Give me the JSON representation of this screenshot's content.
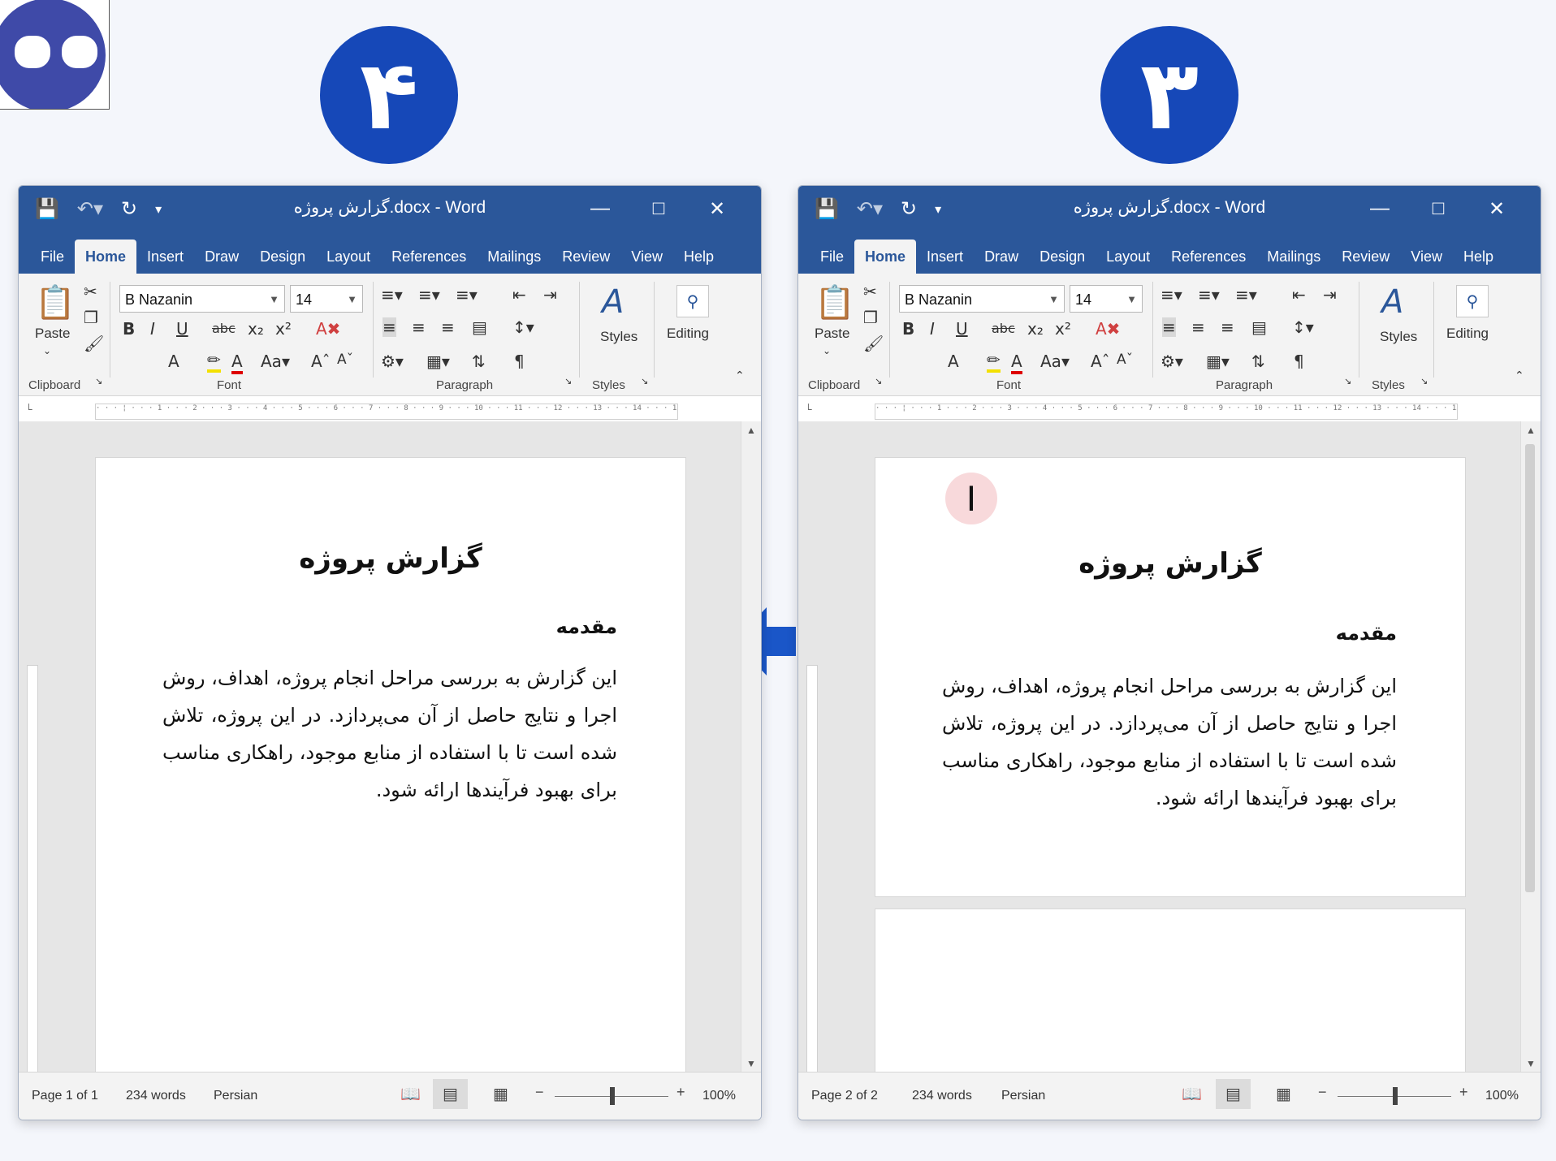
{
  "badges": {
    "left": "۴",
    "right": "۳"
  },
  "windows": [
    {
      "id": "left",
      "title": "گزارش پروژه.docx  -  Word",
      "tabs": [
        "File",
        "Home",
        "Insert",
        "Draw",
        "Design",
        "Layout",
        "References",
        "Mailings",
        "Review",
        "View",
        "Help"
      ],
      "ribbon": {
        "paste": "Paste",
        "font_name": "B Nazanin",
        "font_size": "14",
        "styles": "Styles",
        "editing": "Editing",
        "groups": {
          "clipboard": "Clipboard",
          "font": "Font",
          "paragraph": "Paragraph",
          "styles": "Styles"
        }
      },
      "doc": {
        "title": "گزارش پروژه",
        "heading": "مقدمه",
        "paragraph": "این گزارش به بررسی مراحل انجام پروژه، اهداف، روش اجرا و نتایج حاصل از آن می‌پردازد. در این پروژه، تلاش شده است تا با استفاده از منابع موجود، راهکاری مناسب برای بهبود فرآیندها ارائه شود."
      },
      "status": {
        "page": "Page 1 of 1",
        "words": "234 words",
        "language": "Persian",
        "zoom": "100%"
      }
    },
    {
      "id": "right",
      "title": "گزارش پروژه.docx  -  Word",
      "tabs": [
        "File",
        "Home",
        "Insert",
        "Draw",
        "Design",
        "Layout",
        "References",
        "Mailings",
        "Review",
        "View",
        "Help"
      ],
      "ribbon": {
        "paste": "Paste",
        "font_name": "B Nazanin",
        "font_size": "14",
        "styles": "Styles",
        "editing": "Editing",
        "groups": {
          "clipboard": "Clipboard",
          "font": "Font",
          "paragraph": "Paragraph",
          "styles": "Styles"
        }
      },
      "doc": {
        "title": "گزارش پروژه",
        "heading": "مقدمه",
        "paragraph": "این گزارش به بررسی مراحل انجام پروژه، اهداف، روش اجرا و نتایج حاصل از آن می‌پردازد. در این پروژه، تلاش شده است تا با استفاده از منابع موجود، راهکاری مناسب برای بهبود فرآیندها ارائه شود."
      },
      "status": {
        "page": "Page 2 of 2",
        "words": "234 words",
        "language": "Persian",
        "zoom": "100%"
      }
    }
  ],
  "colors": {
    "word_blue": "#2b579a",
    "badge_blue": "#1648b8",
    "arrow_blue": "#1a56c8"
  }
}
